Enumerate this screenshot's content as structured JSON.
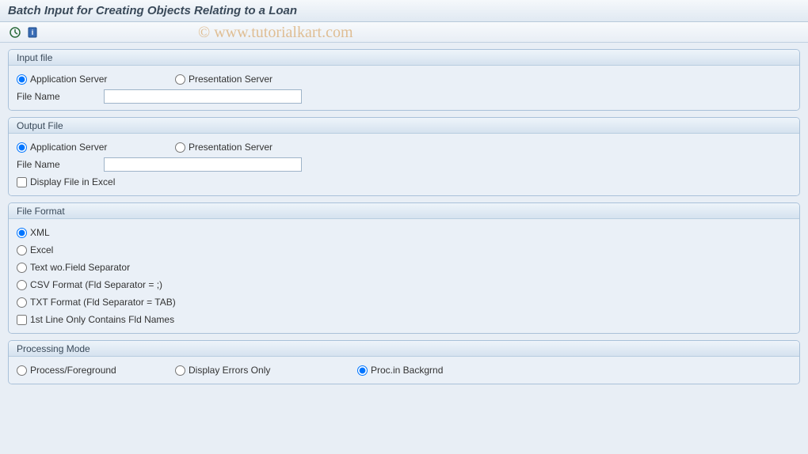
{
  "header": {
    "title": "Batch Input for Creating Objects Relating to a Loan"
  },
  "watermark": "© www.tutorialkart.com",
  "toolbar": {
    "icon1": "execute-icon",
    "icon2": "info-icon"
  },
  "groups": {
    "input_file": {
      "title": "Input file",
      "app_server": "Application Server",
      "pres_server": "Presentation Server",
      "file_name_label": "File Name",
      "file_name_value": ""
    },
    "output_file": {
      "title": "Output File",
      "app_server": "Application Server",
      "pres_server": "Presentation Server",
      "file_name_label": "File Name",
      "file_name_value": "",
      "display_excel": "Display File in Excel"
    },
    "file_format": {
      "title": "File Format",
      "xml": "XML",
      "excel": "Excel",
      "text_wo": "Text wo.Field Separator",
      "csv": "CSV Format (Fld Separator = ;)",
      "txt": "TXT Format (Fld Separator = TAB)",
      "first_line": "1st Line Only Contains Fld Names"
    },
    "processing_mode": {
      "title": "Processing Mode",
      "foreground": "Process/Foreground",
      "errors": "Display Errors Only",
      "background": "Proc.in Backgrnd"
    }
  }
}
